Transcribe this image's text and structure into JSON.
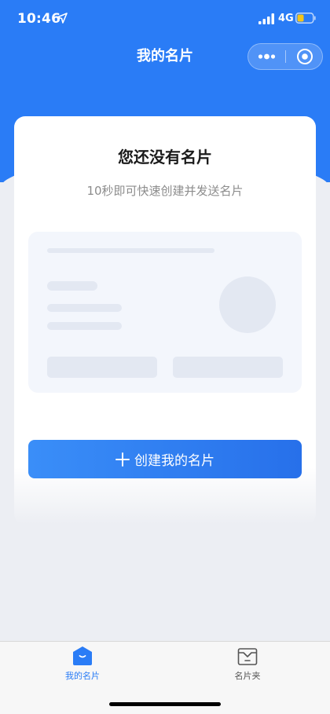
{
  "status_bar": {
    "time": "10:46",
    "network": "4G",
    "location_icon": "location-arrow-icon",
    "signal_icon": "signal-bars-icon",
    "battery_icon": "battery-low-icon",
    "battery_color": "#f5c518"
  },
  "nav": {
    "title": "我的名片",
    "more_icon": "more-dots-icon",
    "close_icon": "target-close-icon"
  },
  "empty_state": {
    "title": "您还没有名片",
    "subtitle": "10秒即可快速创建并发送名片"
  },
  "create_button": {
    "icon": "plus-icon",
    "label": "创建我的名片"
  },
  "tab_bar": {
    "tabs": [
      {
        "label": "我的名片",
        "icon": "home-card-icon",
        "active": true
      },
      {
        "label": "名片夹",
        "icon": "card-holder-icon",
        "active": false
      }
    ]
  },
  "colors": {
    "primary": "#2a7cf6",
    "background": "#eceef3",
    "placeholder": "#e3e8f2"
  }
}
